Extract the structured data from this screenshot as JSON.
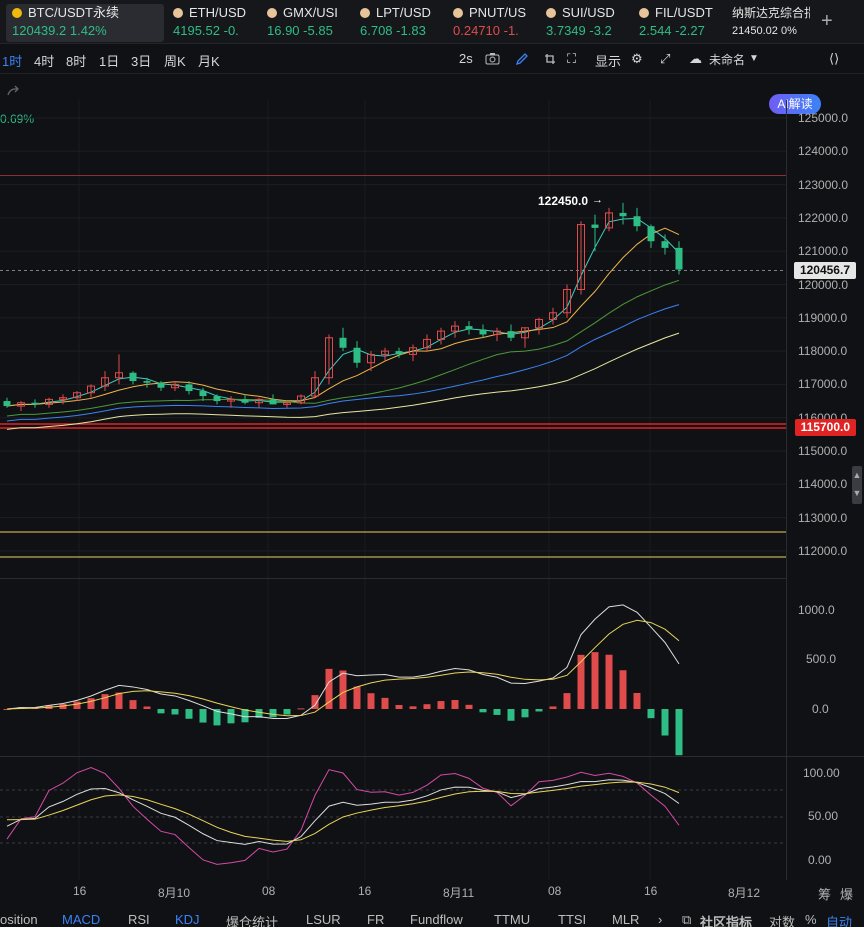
{
  "tabs": [
    {
      "name": "BTC/USDT永续",
      "price": "120439.2",
      "change": "1.42%",
      "dot": "#f0b90b",
      "active": true
    },
    {
      "name": "ETH/USD",
      "price": "4195.52",
      "change": "-0.",
      "dot": "#e8c49a"
    },
    {
      "name": "GMX/USI",
      "price": "16.90",
      "change": "-5.85",
      "dot": "#e8c49a"
    },
    {
      "name": "LPT/USD",
      "price": "6.708",
      "change": "-1.83",
      "dot": "#e8c49a"
    },
    {
      "name": "PNUT/US",
      "price": "0.24710",
      "change": "-1.",
      "dot": "#e8c49a"
    },
    {
      "name": "SUI/USD",
      "price": "3.7349",
      "change": "-3.2",
      "dot": "#e8c49a"
    },
    {
      "name": "FIL/USDT",
      "price": "2.544",
      "change": "-2.27",
      "dot": "#e8c49a"
    },
    {
      "name": "纳斯达克综合指",
      "price": "21450.02",
      "change": "0%"
    }
  ],
  "timeframes": [
    "1时",
    "4时",
    "8时",
    "1日",
    "3日",
    "周K",
    "月K"
  ],
  "toolbar": {
    "interval": "2s",
    "display": "显示",
    "template": "未命名",
    "ai": "AI解读",
    "plus": "+"
  },
  "colors": {
    "up": "#2ebd85",
    "down": "#e04b4b",
    "accent": "#3b82f6"
  },
  "main_chart": {
    "pct_label": "0.69%",
    "y_labels": [
      "125000.0",
      "124000.0",
      "123000.0",
      "122000.0",
      "121000.0",
      "120000.0",
      "119000.0",
      "118000.0",
      "117000.0",
      "116000.0",
      "115000.0",
      "114000.0",
      "113000.0",
      "112000.0"
    ],
    "current_price": "120456.7",
    "level_price": "115700.0",
    "high_label": "122450.0"
  },
  "macd": {
    "y_labels": [
      "1000.0",
      "500.0",
      "0.0"
    ]
  },
  "kdj": {
    "y_labels": [
      "100.00",
      "50.00",
      "0.00"
    ]
  },
  "x_labels": [
    "16",
    "8月10",
    "08",
    "16",
    "8月11",
    "08",
    "16",
    "8月12"
  ],
  "bottom_tabs": [
    "osition",
    "MACD",
    "RSI",
    "KDJ",
    "爆仓统计",
    "LSUR",
    "FR",
    "Fundflow",
    "TTMU",
    "TTSI",
    "MLR"
  ],
  "bottom_right": {
    "community": "社区指标",
    "log": "对数",
    "pct": "%",
    "auto": "自动",
    "collapse": "筹",
    "burst": "爆"
  },
  "chart_data": {
    "type": "candlestick",
    "y_range": [
      111000,
      125000
    ],
    "current_price": 120456.7,
    "high": 122450.0,
    "level": 115700.0,
    "candles": [
      [
        116500,
        116600,
        116300,
        116350
      ],
      [
        116350,
        116500,
        116200,
        116450
      ],
      [
        116450,
        116550,
        116300,
        116400
      ],
      [
        116400,
        116600,
        116300,
        116550
      ],
      [
        116550,
        116700,
        116400,
        116600
      ],
      [
        116600,
        116800,
        116500,
        116750
      ],
      [
        116750,
        117000,
        116600,
        116950
      ],
      [
        116950,
        117400,
        116800,
        117200
      ],
      [
        117200,
        117900,
        117000,
        117350
      ],
      [
        117350,
        117400,
        117000,
        117100
      ],
      [
        117100,
        117200,
        116900,
        117050
      ],
      [
        117050,
        117100,
        116800,
        116900
      ],
      [
        116900,
        117100,
        116800,
        117000
      ],
      [
        117000,
        117100,
        116700,
        116800
      ],
      [
        116800,
        116900,
        116500,
        116650
      ],
      [
        116650,
        116700,
        116400,
        116500
      ],
      [
        116500,
        116650,
        116300,
        116550
      ],
      [
        116550,
        116700,
        116400,
        116450
      ],
      [
        116450,
        116600,
        116300,
        116550
      ],
      [
        116550,
        116700,
        116400,
        116400
      ],
      [
        116400,
        116500,
        116300,
        116450
      ],
      [
        116450,
        116700,
        116400,
        116650
      ],
      [
        116650,
        117400,
        116600,
        117200
      ],
      [
        117200,
        118500,
        117000,
        118400
      ],
      [
        118400,
        118700,
        118000,
        118100
      ],
      [
        118100,
        118300,
        117500,
        117650
      ],
      [
        117650,
        118000,
        117400,
        117900
      ],
      [
        117900,
        118100,
        117700,
        118000
      ],
      [
        118000,
        118100,
        117800,
        117900
      ],
      [
        117900,
        118200,
        117700,
        118100
      ],
      [
        118100,
        118500,
        118000,
        118350
      ],
      [
        118350,
        118700,
        118200,
        118600
      ],
      [
        118600,
        118900,
        118400,
        118750
      ],
      [
        118750,
        118900,
        118500,
        118650
      ],
      [
        118650,
        118800,
        118400,
        118500
      ],
      [
        118500,
        118700,
        118300,
        118600
      ],
      [
        118600,
        118800,
        118300,
        118400
      ],
      [
        118400,
        118700,
        118100,
        118700
      ],
      [
        118700,
        119000,
        118500,
        118950
      ],
      [
        118950,
        119300,
        118800,
        119150
      ],
      [
        119150,
        120000,
        119000,
        119850
      ],
      [
        119850,
        121900,
        119700,
        121800
      ],
      [
        121800,
        122100,
        121000,
        121700
      ],
      [
        121700,
        122300,
        121600,
        122150
      ],
      [
        122150,
        122450,
        121800,
        122050
      ],
      [
        122050,
        122300,
        121600,
        121750
      ],
      [
        121750,
        121800,
        121100,
        121300
      ],
      [
        121300,
        121500,
        120900,
        121100
      ],
      [
        121100,
        121300,
        120300,
        120450
      ]
    ]
  }
}
